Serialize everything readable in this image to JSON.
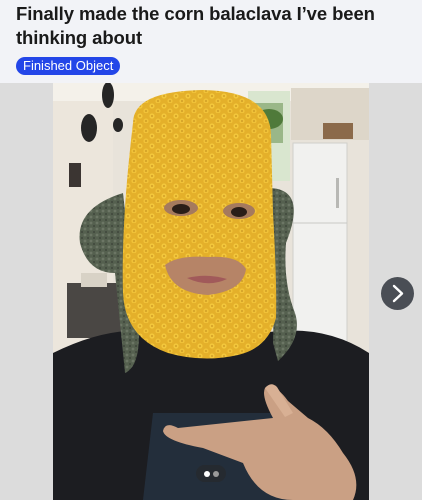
{
  "post": {
    "title": "Finally made the corn balaclava I’ve been thinking about",
    "category_badge": "Finished Object"
  },
  "gallery": {
    "image_description_icon": "photo-of-person-wearing-yellow-crocheted-corn-balaclava",
    "next_icon": "chevron-right-icon",
    "page_count": 2,
    "current_page": 1
  },
  "colors": {
    "badge": "#2346e8",
    "header_background": "#f2f3f7",
    "balaclava_yellow": "#e8b62c",
    "husk_green": "#5a6354"
  }
}
